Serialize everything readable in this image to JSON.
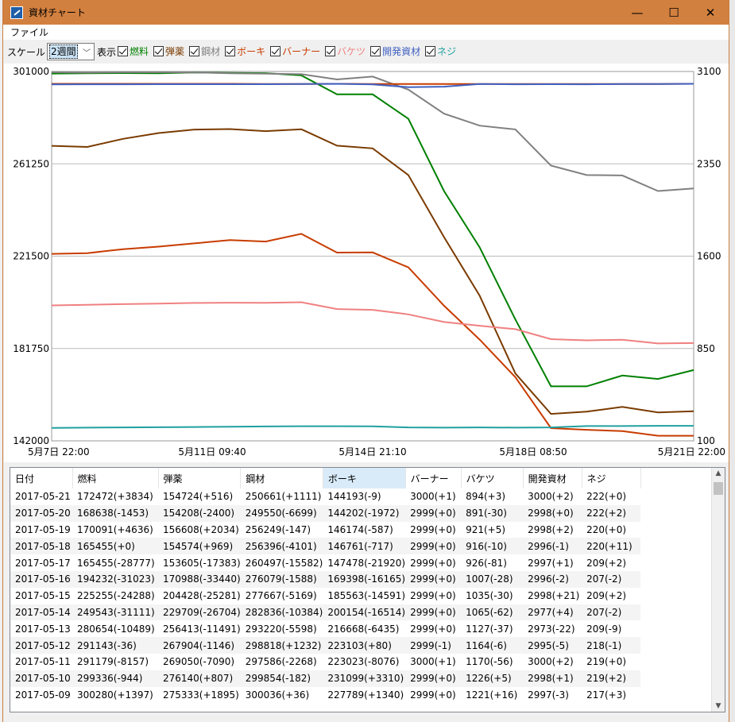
{
  "window": {
    "title": "資材チャート",
    "controls": [
      "—",
      "☐",
      "✕"
    ]
  },
  "menu": [
    "ファイル"
  ],
  "toolbar": {
    "scale_label": "スケール",
    "scale_value": "2週間",
    "display_label": "表示",
    "series": [
      {
        "label": "燃料",
        "color": "#008000"
      },
      {
        "label": "弾薬",
        "color": "#7a3b00"
      },
      {
        "label": "鋼材",
        "color": "#808080"
      },
      {
        "label": "ボーキ",
        "color": "#c83c00"
      },
      {
        "label": "バーナー",
        "color": "#c83c00"
      },
      {
        "label": "バケツ",
        "color": "#f08080"
      },
      {
        "label": "開発資材",
        "color": "#4060c0"
      },
      {
        "label": "ネジ",
        "color": "#20a0a0"
      }
    ]
  },
  "chart_data": {
    "type": "line",
    "x_ticks": [
      "5月7日 22:00",
      "5月11日 09:40",
      "5月14日 21:10",
      "5月18日 08:50",
      "5月21日 22:00"
    ],
    "left_axis": {
      "ticks": [
        "301000",
        "261250",
        "221500",
        "181750",
        "142000"
      ],
      "ylim": [
        142000,
        301000
      ]
    },
    "right_axis": {
      "ticks": [
        "3100",
        "2350",
        "1600",
        "850",
        "100"
      ],
      "ylim": [
        100,
        3100
      ]
    },
    "x_days": [
      "05-07 22:00",
      "05-21 22:00"
    ],
    "series": [
      {
        "name": "燃料",
        "axis": "left",
        "color": "#008000",
        "values": [
          300100,
          300200,
          300300,
          300200,
          300600,
          300400,
          300280,
          299336,
          291179,
          291143,
          280654,
          249543,
          225255,
          194232,
          165455,
          165455,
          170091,
          168638,
          172472
        ]
      },
      {
        "name": "弾薬",
        "axis": "left",
        "color": "#7a3b00",
        "values": [
          269000,
          268500,
          272000,
          274500,
          276000,
          276200,
          275333,
          276140,
          269050,
          267904,
          256413,
          229709,
          204428,
          170988,
          153605,
          154574,
          156608,
          154208,
          154724
        ]
      },
      {
        "name": "鋼材",
        "axis": "left",
        "color": "#808080",
        "values": [
          300800,
          300500,
          300700,
          300900,
          300600,
          300200,
          300036,
          299854,
          297586,
          298818,
          293220,
          282836,
          277667,
          276079,
          260497,
          256396,
          256249,
          249550,
          250661
        ]
      },
      {
        "name": "ボーキ",
        "axis": "left",
        "color": "#c83c00",
        "values": [
          222500,
          222800,
          224500,
          225600,
          227000,
          228400,
          227789,
          231099,
          223023,
          223103,
          216668,
          200154,
          185563,
          169398,
          147478,
          146761,
          146174,
          144202,
          144193
        ]
      },
      {
        "name": "バーナー",
        "axis": "right",
        "color": "#c83c00",
        "values": [
          3000,
          3000,
          3000,
          3000,
          3000,
          3000,
          2999,
          2999,
          3000,
          2999,
          2999,
          2999,
          2999,
          2999,
          2999,
          2999,
          2999,
          2999,
          3000
        ]
      },
      {
        "name": "バケツ",
        "axis": "right",
        "color": "#f08080",
        "values": [
          1200,
          1205,
          1210,
          1215,
          1220,
          1222,
          1221,
          1226,
          1170,
          1164,
          1127,
          1065,
          1035,
          1007,
          926,
          916,
          921,
          891,
          894
        ]
      },
      {
        "name": "開発資材",
        "axis": "right",
        "color": "#4060c0",
        "values": [
          2995,
          2996,
          2996,
          2997,
          2997,
          2997,
          2997,
          2998,
          3000,
          2995,
          2973,
          2977,
          2998,
          2996,
          2997,
          2996,
          2998,
          2998,
          3000
        ]
      },
      {
        "name": "ネジ",
        "axis": "right",
        "color": "#20a0a0",
        "values": [
          205,
          207,
          209,
          210,
          212,
          214,
          217,
          219,
          219,
          218,
          209,
          207,
          209,
          207,
          209,
          220,
          220,
          222,
          222
        ]
      }
    ]
  },
  "table": {
    "columns": [
      "日付",
      "燃料",
      "弾薬",
      "鋼材",
      "ボーキ",
      "バーナー",
      "バケツ",
      "開発資材",
      "ネジ"
    ],
    "rows": [
      [
        "2017-05-21",
        "172472(+3834)",
        "154724(+516)",
        "250661(+1111)",
        "144193(-9)",
        "3000(+1)",
        "894(+3)",
        "3000(+2)",
        "222(+0)"
      ],
      [
        "2017-05-20",
        "168638(-1453)",
        "154208(-2400)",
        "249550(-6699)",
        "144202(-1972)",
        "2999(+0)",
        "891(-30)",
        "2998(+0)",
        "222(+2)"
      ],
      [
        "2017-05-19",
        "170091(+4636)",
        "156608(+2034)",
        "256249(-147)",
        "146174(-587)",
        "2999(+0)",
        "921(+5)",
        "2998(+2)",
        "220(+0)"
      ],
      [
        "2017-05-18",
        "165455(+0)",
        "154574(+969)",
        "256396(-4101)",
        "146761(-717)",
        "2999(+0)",
        "916(-10)",
        "2996(-1)",
        "220(+11)"
      ],
      [
        "2017-05-17",
        "165455(-28777)",
        "153605(-17383)",
        "260497(-15582)",
        "147478(-21920)",
        "2999(+0)",
        "926(-81)",
        "2997(+1)",
        "209(+2)"
      ],
      [
        "2017-05-16",
        "194232(-31023)",
        "170988(-33440)",
        "276079(-1588)",
        "169398(-16165)",
        "2999(+0)",
        "1007(-28)",
        "2996(-2)",
        "207(-2)"
      ],
      [
        "2017-05-15",
        "225255(-24288)",
        "204428(-25281)",
        "277667(-5169)",
        "185563(-14591)",
        "2999(+0)",
        "1035(-30)",
        "2998(+21)",
        "209(+2)"
      ],
      [
        "2017-05-14",
        "249543(-31111)",
        "229709(-26704)",
        "282836(-10384)",
        "200154(-16514)",
        "2999(+0)",
        "1065(-62)",
        "2977(+4)",
        "207(-2)"
      ],
      [
        "2017-05-13",
        "280654(-10489)",
        "256413(-11491)",
        "293220(-5598)",
        "216668(-6435)",
        "2999(+0)",
        "1127(-37)",
        "2973(-22)",
        "209(-9)"
      ],
      [
        "2017-05-12",
        "291143(-36)",
        "267904(-1146)",
        "298818(+1232)",
        "223103(+80)",
        "2999(-1)",
        "1164(-6)",
        "2995(-5)",
        "218(-1)"
      ],
      [
        "2017-05-11",
        "291179(-8157)",
        "269050(-7090)",
        "297586(-2268)",
        "223023(-8076)",
        "3000(+1)",
        "1170(-56)",
        "3000(+2)",
        "219(+0)"
      ],
      [
        "2017-05-10",
        "299336(-944)",
        "276140(+807)",
        "299854(-182)",
        "231099(+3310)",
        "2999(+0)",
        "1226(+5)",
        "2998(+1)",
        "219(+2)"
      ],
      [
        "2017-05-09",
        "300280(+1397)",
        "275333(+1895)",
        "300036(+36)",
        "227789(+1340)",
        "2999(+0)",
        "1221(+16)",
        "2997(-3)",
        "217(+3)"
      ]
    ]
  }
}
